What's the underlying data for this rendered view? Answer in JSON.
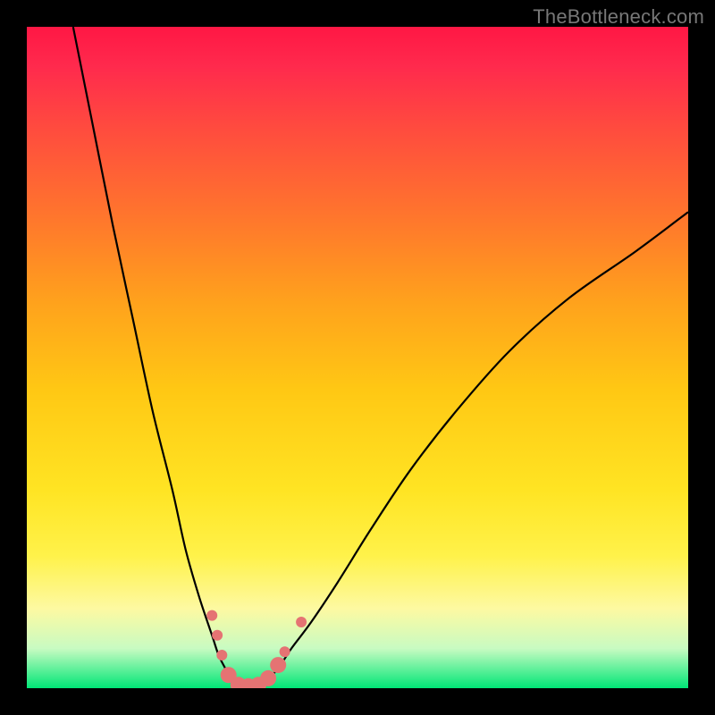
{
  "watermark": "TheBottleneck.com",
  "chart_data": {
    "type": "line",
    "title": "",
    "xlabel": "",
    "ylabel": "",
    "xlim": [
      0,
      100
    ],
    "ylim": [
      0,
      100
    ],
    "grid": false,
    "legend": false,
    "series": [
      {
        "name": "bottleneck-curve",
        "color": "#000000",
        "x": [
          7,
          10,
          13,
          16,
          19,
          22,
          24,
          26,
          28,
          29,
          30,
          31,
          32,
          33,
          34,
          36,
          38,
          40,
          43,
          47,
          52,
          58,
          65,
          73,
          82,
          92,
          100
        ],
        "y": [
          100,
          85,
          70,
          56,
          42,
          30,
          21,
          14,
          8,
          5,
          3,
          1,
          0,
          0,
          0,
          1,
          3,
          6,
          10,
          16,
          24,
          33,
          42,
          51,
          59,
          66,
          72
        ]
      }
    ],
    "markers": [
      {
        "name": "sample-points",
        "color": "#e57373",
        "radius_small": 6,
        "radius_large": 9,
        "points": [
          {
            "x": 28.0,
            "y": 11.0,
            "r": "small"
          },
          {
            "x": 28.8,
            "y": 8.0,
            "r": "small"
          },
          {
            "x": 29.5,
            "y": 5.0,
            "r": "small"
          },
          {
            "x": 30.5,
            "y": 2.0,
            "r": "large"
          },
          {
            "x": 32.0,
            "y": 0.5,
            "r": "large"
          },
          {
            "x": 33.5,
            "y": 0.3,
            "r": "large"
          },
          {
            "x": 35.0,
            "y": 0.5,
            "r": "large"
          },
          {
            "x": 36.5,
            "y": 1.5,
            "r": "large"
          },
          {
            "x": 38.0,
            "y": 3.5,
            "r": "large"
          },
          {
            "x": 39.0,
            "y": 5.5,
            "r": "small"
          },
          {
            "x": 41.5,
            "y": 10.0,
            "r": "small"
          }
        ]
      }
    ],
    "background_gradient": {
      "top": "#ff1744",
      "mid_upper": "#ff7a2b",
      "mid": "#ffe423",
      "mid_lower": "#fdf9a2",
      "bottom": "#00e676"
    }
  }
}
